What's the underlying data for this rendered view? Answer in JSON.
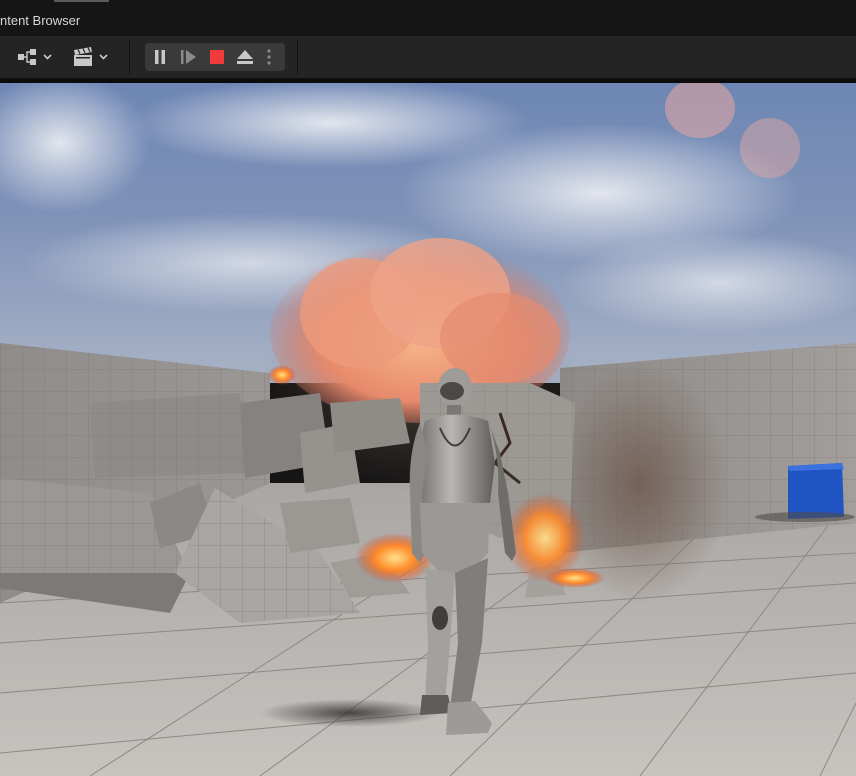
{
  "window": {
    "tab_label": "ntent Browser"
  },
  "toolbar": {
    "buttons": [
      {
        "name": "blueprint-graph-button",
        "icon": "node-graph-icon",
        "has_dropdown": true
      },
      {
        "name": "cinematics-button",
        "icon": "clapperboard-icon",
        "has_dropdown": true
      }
    ],
    "play_controls": [
      {
        "name": "pause-button",
        "icon": "pause-icon"
      },
      {
        "name": "frame-advance-button",
        "icon": "frame-advance-icon"
      },
      {
        "name": "stop-button",
        "icon": "stop-icon",
        "color": "#f13a3a"
      },
      {
        "name": "eject-button",
        "icon": "eject-icon"
      },
      {
        "name": "more-options-button",
        "icon": "kebab-icon"
      }
    ]
  },
  "colors": {
    "toolbar_bg": "#242424",
    "tabbar_bg": "#151515",
    "stop_red": "#f13a3a",
    "icon_gray": "#c8c8c8"
  }
}
